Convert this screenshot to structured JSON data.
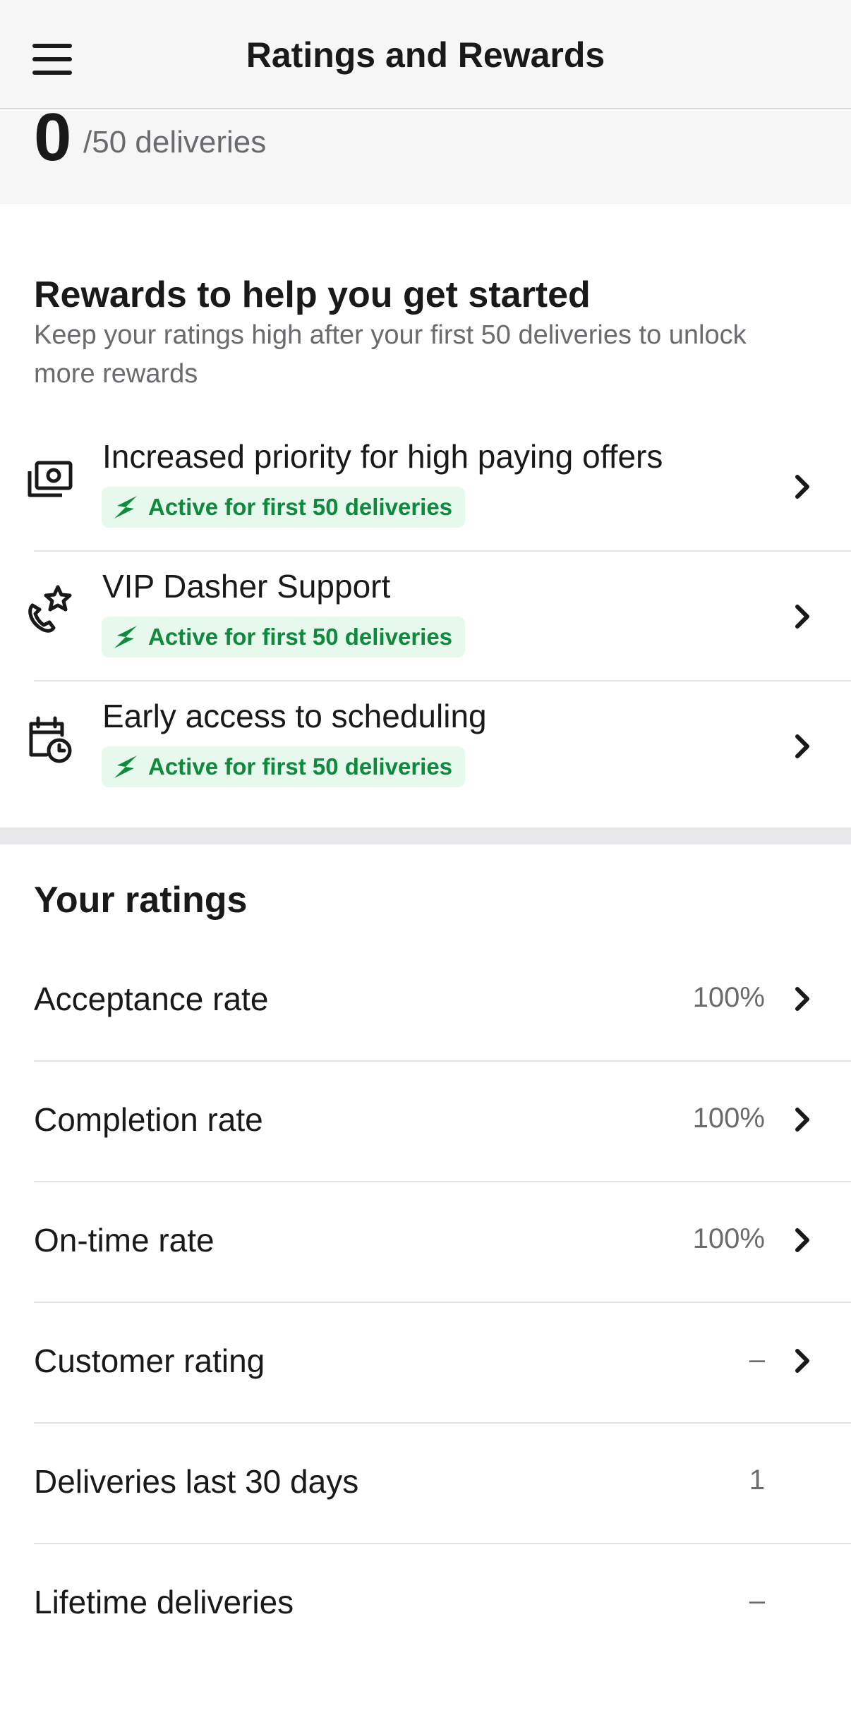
{
  "header": {
    "title": "Ratings and Rewards",
    "menu_icon": "hamburger-menu-icon"
  },
  "deliveries": {
    "count": "0",
    "suffix": "/50 deliveries"
  },
  "rewards": {
    "title": "Rewards to help you get started",
    "subtitle": "Keep your ratings high after your first 50 deliveries to unlock more rewards",
    "items": [
      {
        "title": "Increased priority for high paying offers",
        "badge": "Active for first 50 deliveries",
        "icon": "money-stack-icon"
      },
      {
        "title": "VIP Dasher Support",
        "badge": "Active for first 50 deliveries",
        "icon": "phone-star-icon"
      },
      {
        "title": "Early access to scheduling",
        "badge": "Active for first 50 deliveries",
        "icon": "calendar-clock-icon"
      }
    ]
  },
  "ratings": {
    "title": "Your ratings",
    "items": [
      {
        "label": "Acceptance rate",
        "value": "100%"
      },
      {
        "label": "Completion rate",
        "value": "100%"
      },
      {
        "label": "On-time rate",
        "value": "100%"
      },
      {
        "label": "Customer rating",
        "value": "–"
      },
      {
        "label": "Deliveries last 30 days",
        "value": "1"
      },
      {
        "label": "Lifetime deliveries",
        "value": "–"
      }
    ]
  },
  "colors": {
    "accent_green": "#0d8a3b",
    "badge_bg": "#e7f8ec",
    "header_bg": "#f6f6f7"
  }
}
